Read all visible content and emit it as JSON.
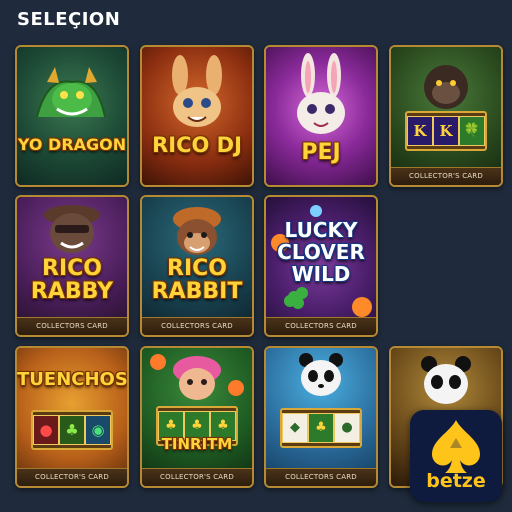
{
  "header": {
    "title": "SELEÇION"
  },
  "cards": [
    {
      "title": "YO DRAGON",
      "footer": ""
    },
    {
      "title": "RICO DJ",
      "footer": ""
    },
    {
      "title": "PEJ",
      "footer": ""
    },
    {
      "title": "",
      "footer": "COLLECTOR'S CARD",
      "reels": [
        "K",
        "K",
        "🍀"
      ]
    },
    {
      "title_line1": "RICO",
      "title_line2": "RABBY",
      "footer": "COLLECTORS CARD"
    },
    {
      "title_line1": "RICO",
      "title_line2": "RABBIT",
      "footer": "COLLECTORS CARD"
    },
    {
      "title_line1": "LUCKY",
      "title_line2": "CLOVER",
      "title_line3": "WILD",
      "footer": "COLLECTORS CARD"
    },
    {
      "title": "TUENCHOS",
      "footer": "COLLECTOR'S CARD"
    },
    {
      "title": "TINRITM",
      "footer": "COLLECTOR'S CARD"
    },
    {
      "title": "",
      "footer": "COLLECTORS CARD"
    },
    {
      "title": "",
      "footer": ""
    }
  ],
  "logo": {
    "brand": "betze"
  },
  "colors": {
    "background": "#1f2b3c",
    "card_border": "#b58a32",
    "title_gold": "#ffd43a",
    "brand": "#ffc41a"
  }
}
